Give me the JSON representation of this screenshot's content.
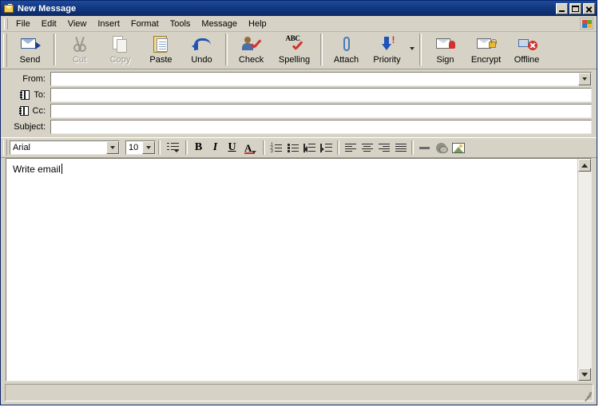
{
  "window": {
    "title": "New Message",
    "icon": "new-message-envelope-icon",
    "controls": {
      "minimize": "Minimize",
      "maximize": "Maximize",
      "close": "Close"
    }
  },
  "menubar": {
    "items": [
      {
        "label": "File"
      },
      {
        "label": "Edit"
      },
      {
        "label": "View"
      },
      {
        "label": "Insert"
      },
      {
        "label": "Format"
      },
      {
        "label": "Tools"
      },
      {
        "label": "Message"
      },
      {
        "label": "Help"
      }
    ],
    "logo": "windows-flag-icon"
  },
  "toolbar": {
    "buttons": [
      {
        "label": "Send",
        "icon": "send-envelope-icon",
        "enabled": true
      },
      {
        "label": "Cut",
        "icon": "scissors-icon",
        "enabled": false
      },
      {
        "label": "Copy",
        "icon": "copy-pages-icon",
        "enabled": false
      },
      {
        "label": "Paste",
        "icon": "clipboard-icon",
        "enabled": true
      },
      {
        "label": "Undo",
        "icon": "undo-arrow-icon",
        "enabled": true
      },
      {
        "label": "Check",
        "icon": "check-names-icon",
        "enabled": true
      },
      {
        "label": "Spelling",
        "icon": "spelling-abc-icon",
        "enabled": true
      },
      {
        "label": "Attach",
        "icon": "paperclip-icon",
        "enabled": true
      },
      {
        "label": "Priority",
        "icon": "priority-arrow-icon",
        "enabled": true
      },
      {
        "label": "Sign",
        "icon": "sign-ribbon-icon",
        "enabled": true
      },
      {
        "label": "Encrypt",
        "icon": "encrypt-padlock-icon",
        "enabled": true
      },
      {
        "label": "Offline",
        "icon": "work-offline-icon",
        "enabled": true
      }
    ]
  },
  "headers": {
    "from": {
      "label": "From:",
      "value": "",
      "placeholder": ""
    },
    "to": {
      "label": "To:",
      "value": "",
      "placeholder": "",
      "icon": "address-book-icon"
    },
    "cc": {
      "label": "Cc:",
      "value": "",
      "placeholder": "",
      "icon": "address-book-icon"
    },
    "subject": {
      "label": "Subject:",
      "value": "",
      "placeholder": ""
    }
  },
  "format_toolbar": {
    "font_name": "Arial",
    "font_size": "10",
    "buttons": [
      {
        "name": "paragraph-style",
        "label": "Paragraph Style"
      },
      {
        "name": "bold",
        "label": "B"
      },
      {
        "name": "italic",
        "label": "I"
      },
      {
        "name": "underline",
        "label": "U"
      },
      {
        "name": "font-color",
        "label": "A"
      },
      {
        "name": "numbered-list",
        "label": "Numbering"
      },
      {
        "name": "bulleted-list",
        "label": "Bullets"
      },
      {
        "name": "decrease-indent",
        "label": "Decrease Indent"
      },
      {
        "name": "increase-indent",
        "label": "Increase Indent"
      },
      {
        "name": "align-left",
        "label": "Align Left"
      },
      {
        "name": "align-center",
        "label": "Center"
      },
      {
        "name": "align-right",
        "label": "Align Right"
      },
      {
        "name": "justify",
        "label": "Justify"
      },
      {
        "name": "horizontal-line",
        "label": "Insert Horizontal Line"
      },
      {
        "name": "insert-hyperlink",
        "label": "Insert Hyperlink"
      },
      {
        "name": "insert-picture",
        "label": "Insert Picture"
      }
    ]
  },
  "body": {
    "text": "Write email",
    "has_caret": true
  },
  "statusbar": {
    "text": ""
  },
  "colors": {
    "title_bar": "#14387f",
    "window_face": "#d6d3c6",
    "field_bg": "#ffffff",
    "accent_blue": "#1f53b8",
    "accent_red": "#d2322d"
  }
}
